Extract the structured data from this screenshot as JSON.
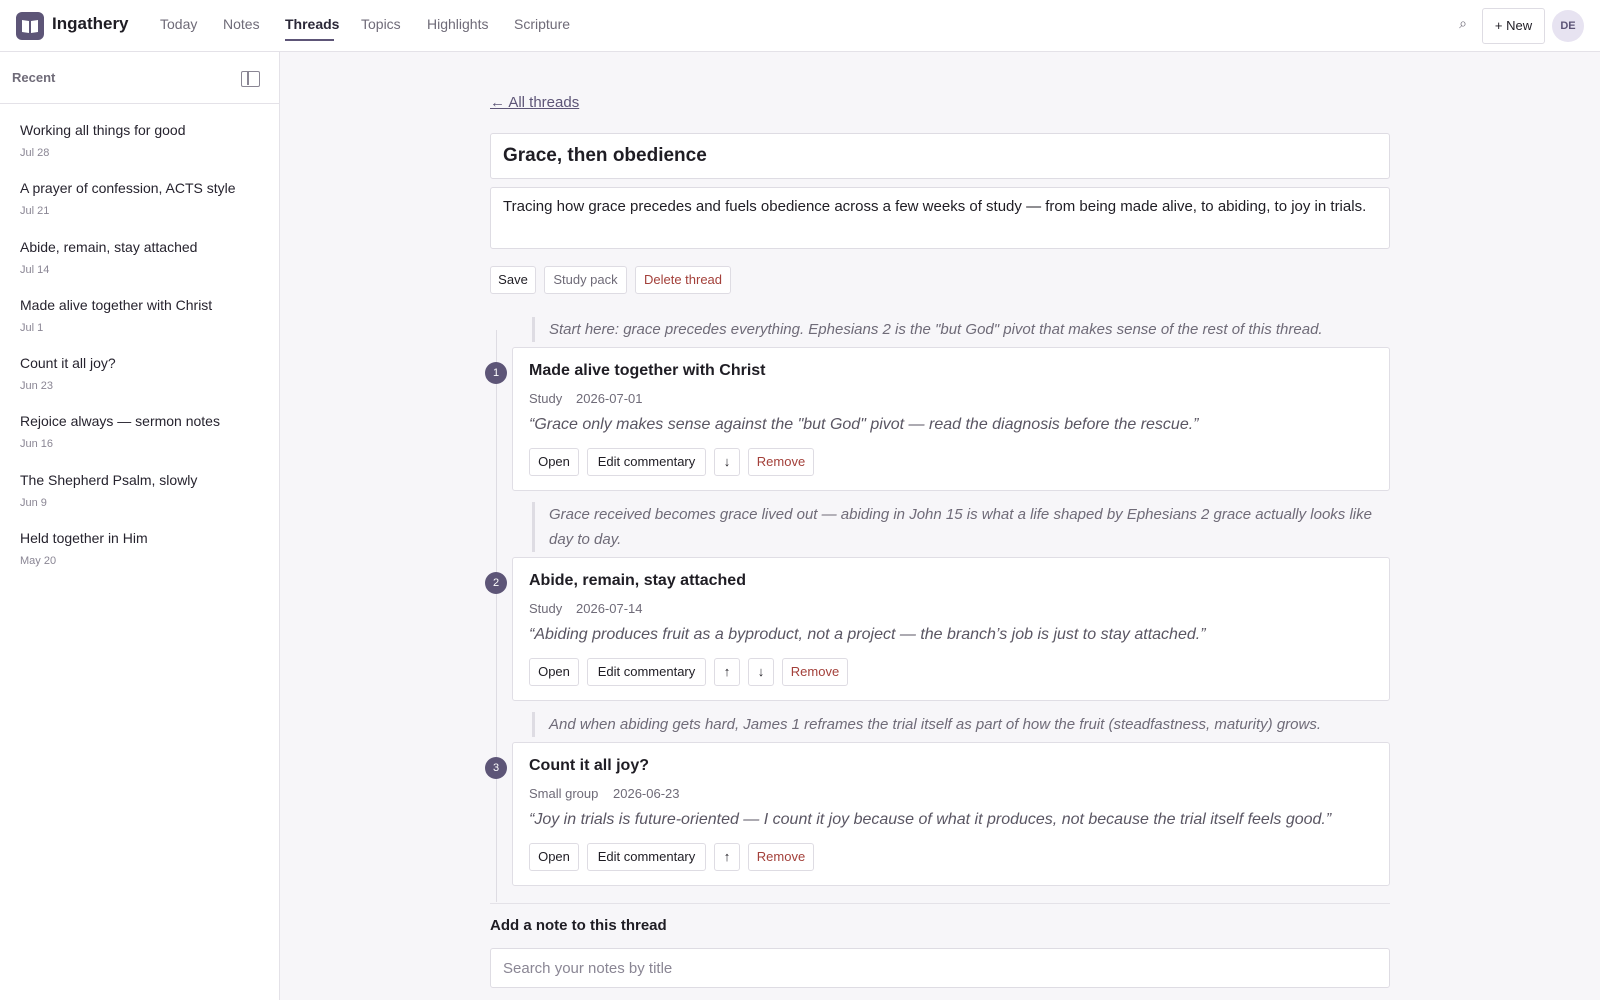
{
  "app": {
    "name": "Ingathery",
    "nav": [
      {
        "label": "Today"
      },
      {
        "label": "Notes"
      },
      {
        "label": "Threads"
      },
      {
        "label": "Topics"
      },
      {
        "label": "Highlights"
      },
      {
        "label": "Scripture"
      }
    ],
    "active_nav": "Threads",
    "search_icon": "⌕",
    "new_label": "+ New",
    "avatar_initials": "DE",
    "accent_color": "#5d5577"
  },
  "sidebar": {
    "title": "Recent",
    "items": [
      {
        "title": "Working all things for good",
        "date": "Jul 28"
      },
      {
        "title": "A prayer of confession, ACTS style",
        "date": "Jul 21"
      },
      {
        "title": "Abide, remain, stay attached",
        "date": "Jul 14"
      },
      {
        "title": "Made alive together with Christ",
        "date": "Jul 1"
      },
      {
        "title": "Count it all joy?",
        "date": "Jun 23"
      },
      {
        "title": "Rejoice always — sermon notes",
        "date": "Jun 16"
      },
      {
        "title": "The Shepherd Psalm, slowly",
        "date": "Jun 9"
      },
      {
        "title": "Held together in Him",
        "date": "May 20"
      }
    ]
  },
  "thread": {
    "back_label": "← All threads",
    "title": "Grace, then obedience",
    "description": "Tracing how grace precedes and fuels obedience across a few weeks of study — from being made alive, to abiding, to joy in trials.",
    "actions": {
      "save": "Save",
      "study_pack": "Study pack",
      "delete": "Delete thread"
    },
    "entries": [
      {
        "commentary": "Start here: grace precedes everything. Ephesians 2 is the \"but God\" pivot that makes sense of the rest of this thread.",
        "number": "1",
        "title": "Made alive together with Christ",
        "kind": "Study",
        "date": "2026-07-01",
        "quote": "“Grace only makes sense against the \"but God\" pivot — read the diagnosis before the rescue.”",
        "buttons": {
          "open": "Open",
          "edit": "Edit commentary",
          "up": "↑",
          "down": "↓",
          "remove": "Remove"
        }
      },
      {
        "commentary": "Grace received becomes grace lived out — abiding in John 15 is what a life shaped by Ephesians 2 grace actually looks like day to day.",
        "number": "2",
        "title": "Abide, remain, stay attached",
        "kind": "Study",
        "date": "2026-07-14",
        "quote": "“Abiding produces fruit as a byproduct, not a project — the branch’s job is just to stay attached.”",
        "buttons": {
          "open": "Open",
          "edit": "Edit commentary",
          "up": "↑",
          "down": "↓",
          "remove": "Remove"
        }
      },
      {
        "commentary": "And when abiding gets hard, James 1 reframes the trial itself as part of how the fruit (steadfastness, maturity) grows.",
        "number": "3",
        "title": "Count it all joy?",
        "kind": "Small group",
        "date": "2026-06-23",
        "quote": "“Joy in trials is future-oriented — I count it joy because of what it produces, not because the trial itself feels good.”",
        "buttons": {
          "open": "Open",
          "edit": "Edit commentary",
          "up": "↑",
          "down": "↓",
          "remove": "Remove"
        }
      }
    ],
    "add_heading": "Add a note to this thread",
    "add_placeholder": "Search your notes by title"
  }
}
